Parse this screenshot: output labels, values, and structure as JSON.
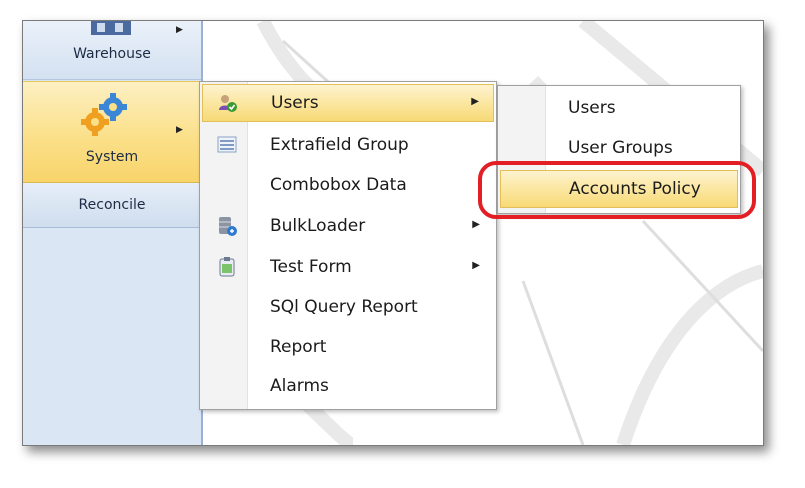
{
  "nav": {
    "warehouse": {
      "label": "Warehouse",
      "icon": "warehouse-icon"
    },
    "system": {
      "label": "System",
      "icon": "gears-icon"
    },
    "reconcile": {
      "label": "Reconcile"
    }
  },
  "menu": {
    "items": [
      {
        "label": "Users",
        "icon": "users-icon",
        "submenu": true,
        "highlighted": true
      },
      {
        "label": "Extrafield Group",
        "icon": "list-icon",
        "submenu": false
      },
      {
        "label": "Combobox Data",
        "icon": "",
        "submenu": false
      },
      {
        "label": "BulkLoader",
        "icon": "database-icon",
        "submenu": true
      },
      {
        "label": "Test Form",
        "icon": "clipboard-icon",
        "submenu": true
      },
      {
        "label": "SQl Query Report",
        "icon": "",
        "submenu": false
      },
      {
        "label": "Report",
        "icon": "",
        "submenu": false
      },
      {
        "label": "Alarms",
        "icon": "",
        "submenu": false
      }
    ]
  },
  "submenu": {
    "items": [
      {
        "label": "Users"
      },
      {
        "label": "User Groups"
      },
      {
        "label": "Accounts Policy",
        "highlighted": true
      }
    ]
  },
  "colors": {
    "highlight": "#fbe7a1",
    "callout": "#e31e24",
    "nav_background": "#dbe6f4"
  }
}
